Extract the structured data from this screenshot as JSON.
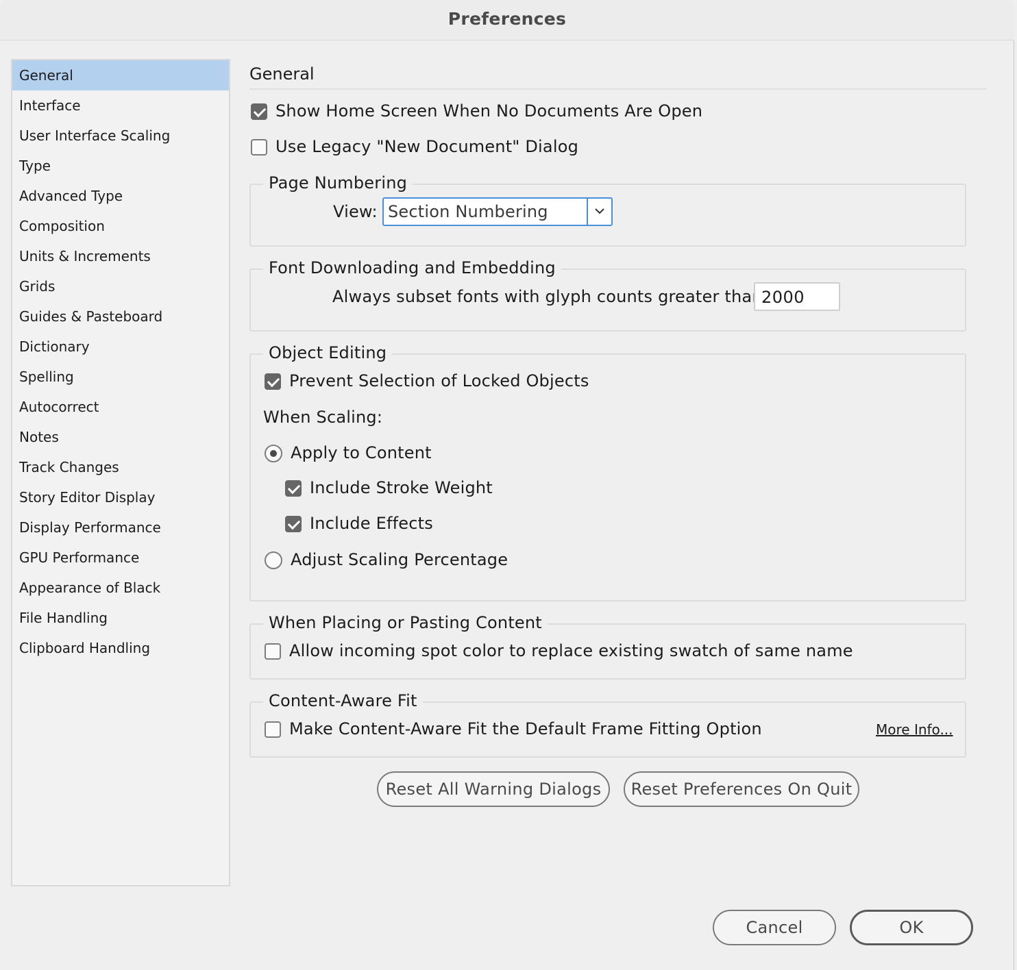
{
  "window": {
    "title": "Preferences"
  },
  "sidebar": {
    "items": [
      {
        "label": "General",
        "selected": true
      },
      {
        "label": "Interface"
      },
      {
        "label": "User Interface Scaling"
      },
      {
        "label": "Type"
      },
      {
        "label": "Advanced Type"
      },
      {
        "label": "Composition"
      },
      {
        "label": "Units & Increments"
      },
      {
        "label": "Grids"
      },
      {
        "label": "Guides & Pasteboard"
      },
      {
        "label": "Dictionary"
      },
      {
        "label": "Spelling"
      },
      {
        "label": "Autocorrect"
      },
      {
        "label": "Notes"
      },
      {
        "label": "Track Changes"
      },
      {
        "label": "Story Editor Display"
      },
      {
        "label": "Display Performance"
      },
      {
        "label": "GPU Performance"
      },
      {
        "label": "Appearance of Black"
      },
      {
        "label": "File Handling"
      },
      {
        "label": "Clipboard Handling"
      }
    ]
  },
  "main": {
    "title": "General",
    "show_home_screen": {
      "label": "Show Home Screen When No Documents Are Open",
      "checked": true
    },
    "legacy_new_doc": {
      "label": "Use Legacy \"New Document\" Dialog",
      "checked": false
    },
    "page_numbering": {
      "legend": "Page Numbering",
      "view_label": "View:",
      "view_value": "Section Numbering"
    },
    "font_downloading": {
      "legend": "Font Downloading and Embedding",
      "subset_label": "Always subset fonts with glyph counts greater than:",
      "subset_value": "2000"
    },
    "object_editing": {
      "legend": "Object Editing",
      "prevent_selection": {
        "label": "Prevent Selection of Locked Objects",
        "checked": true
      },
      "when_scaling": "When Scaling:",
      "apply_to_content": {
        "label": "Apply to Content",
        "selected": true
      },
      "include_stroke": {
        "label": "Include Stroke Weight",
        "checked": true
      },
      "include_effects": {
        "label": "Include Effects",
        "checked": true
      },
      "adjust_scaling": {
        "label": "Adjust Scaling Percentage",
        "selected": false
      }
    },
    "placing": {
      "legend": "When Placing or Pasting Content",
      "allow_spot": {
        "label": "Allow incoming spot color to replace existing swatch of same name",
        "checked": false
      }
    },
    "content_aware": {
      "legend": "Content-Aware Fit",
      "default_option": {
        "label": "Make Content-Aware Fit the Default Frame Fitting Option",
        "checked": false
      },
      "more_info": "More Info..."
    },
    "reset_warnings": "Reset All Warning Dialogs",
    "reset_prefs": "Reset Preferences On Quit"
  },
  "footer": {
    "cancel": "Cancel",
    "ok": "OK"
  },
  "colors": {
    "selection": "#b4d0ef",
    "focus": "#4a90d9",
    "checkbox_fill": "#666666"
  }
}
